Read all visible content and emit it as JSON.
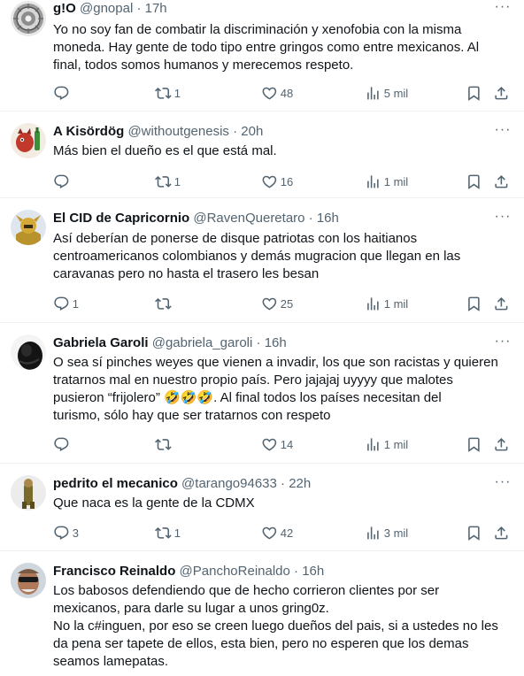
{
  "tweets": [
    {
      "name": "g!O",
      "handle": "@gnopal",
      "time": "· 17h",
      "text": "Yo no soy fan de combatir la discriminación y xenofobia con la misma\nmoneda. Hay gente de todo tipo entre gringos como entre mexicanos. Al\nfinal, todos somos humanos y merecemos respeto.",
      "replies": "",
      "retweets": "1",
      "likes": "48",
      "views": "5 mil"
    },
    {
      "name": "A Kisördög",
      "handle": "@withoutgenesis",
      "time": "· 20h",
      "text": "Más bien el dueño es el que está mal.",
      "replies": "",
      "retweets": "1",
      "likes": "16",
      "views": "1 mil"
    },
    {
      "name": "El CID de Capricornio",
      "handle": "@RavenQueretaro",
      "time": "· 16h",
      "text": "Así deberían de ponerse de disque patriotas con los haitianos\ncentroamericanos colombianos y demás mugracion que llegan en las\ncaravanas pero no hasta el trasero les besan",
      "replies": "1",
      "retweets": "",
      "likes": "25",
      "views": "1 mil"
    },
    {
      "name": "Gabriela Garoli",
      "handle": "@gabriela_garoli",
      "time": "· 16h",
      "text": "O sea sí pinches weyes que vienen a invadir, los que son racistas y quieren\ntratarnos mal en nuestro propio país. Pero jajajaj uyyyy que malotes\npusieron “frijolero” 🤣🤣🤣. Al final todos los países necesitan del\nturismo, sólo hay que ser tratarnos con respeto",
      "replies": "",
      "retweets": "",
      "likes": "14",
      "views": "1 mil"
    },
    {
      "name": "pedrito el mecanico",
      "handle": "@tarango94633",
      "time": "· 22h",
      "text": "Que naca es la gente de la CDMX",
      "replies": "3",
      "retweets": "1",
      "likes": "42",
      "views": "3 mil"
    },
    {
      "name": "Francisco Reinaldo",
      "handle": "@PanchoReinaldo",
      "time": "· 16h",
      "text": "Los babosos defendiendo que de hecho corrieron clientes por ser\nmexicanos, para darle su lugar a unos gring0z.\nNo la c#inguen, por eso se creen luego dueños del pais, si a ustedes no les\nda pena ser tapete de ellos, esta bien, pero no esperen que los demas\nseamos lamepatas."
    }
  ],
  "icons": {
    "reply": "reply-icon",
    "retweet": "retweet-icon",
    "like": "heart-icon",
    "views": "views-icon",
    "bookmark": "bookmark-icon",
    "share": "share-icon",
    "more": "more-icon"
  },
  "colors": {
    "text": "#0f1419",
    "secondary": "#536471",
    "divider": "#eff3f4"
  }
}
